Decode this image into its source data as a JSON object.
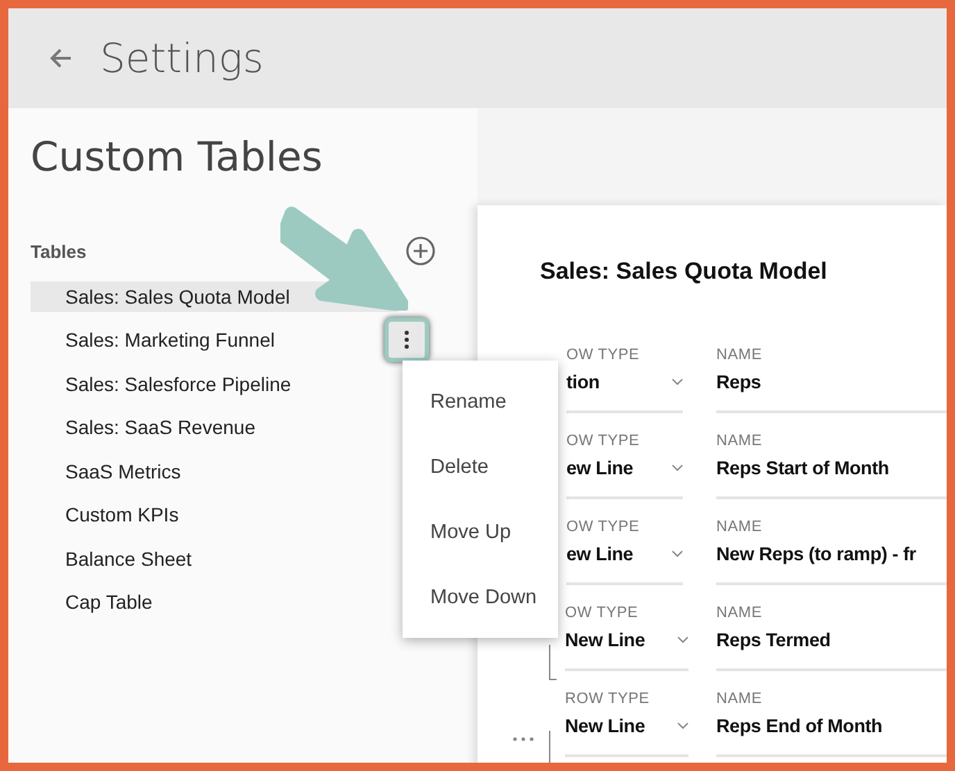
{
  "header": {
    "title": "Settings"
  },
  "sidebar": {
    "heading": "Custom Tables",
    "section_label": "Tables",
    "items": [
      {
        "label": "Sales: Sales Quota Model",
        "selected": true,
        "menu_open": false
      },
      {
        "label": "Sales: Marketing Funnel",
        "selected": false,
        "menu_open": true
      },
      {
        "label": "Sales: Salesforce Pipeline",
        "selected": false,
        "menu_open": false
      },
      {
        "label": "Sales: SaaS Revenue",
        "selected": false,
        "menu_open": false
      },
      {
        "label": "SaaS Metrics",
        "selected": false,
        "menu_open": false
      },
      {
        "label": "Custom KPIs",
        "selected": false,
        "menu_open": false
      },
      {
        "label": "Balance Sheet",
        "selected": false,
        "menu_open": false
      },
      {
        "label": "Cap Table",
        "selected": false,
        "menu_open": false
      }
    ]
  },
  "context_menu": {
    "items": [
      "Rename",
      "Delete",
      "Move Up",
      "Move Down"
    ]
  },
  "content": {
    "title": "Sales: Sales Quota Model",
    "rows": [
      {
        "kind": "covered",
        "type_label": "OW TYPE",
        "type_value": "tion",
        "name_label": "NAME",
        "name_value": "Reps"
      },
      {
        "kind": "covered",
        "type_label": "OW TYPE",
        "type_value": "ew Line",
        "name_label": "NAME",
        "name_value": "Reps Start of Month"
      },
      {
        "kind": "covered",
        "type_label": "OW TYPE",
        "type_value": "ew Line",
        "name_label": "NAME",
        "name_value": "New Reps (to ramp) - fr"
      },
      {
        "kind": "child",
        "type_label": "OW TYPE",
        "type_value": "New Line",
        "name_label": "NAME",
        "name_value": "Reps Termed"
      },
      {
        "kind": "child-more",
        "type_label": "ROW TYPE",
        "type_value": "New Line",
        "name_label": "NAME",
        "name_value": "Reps End of Month"
      }
    ]
  }
}
